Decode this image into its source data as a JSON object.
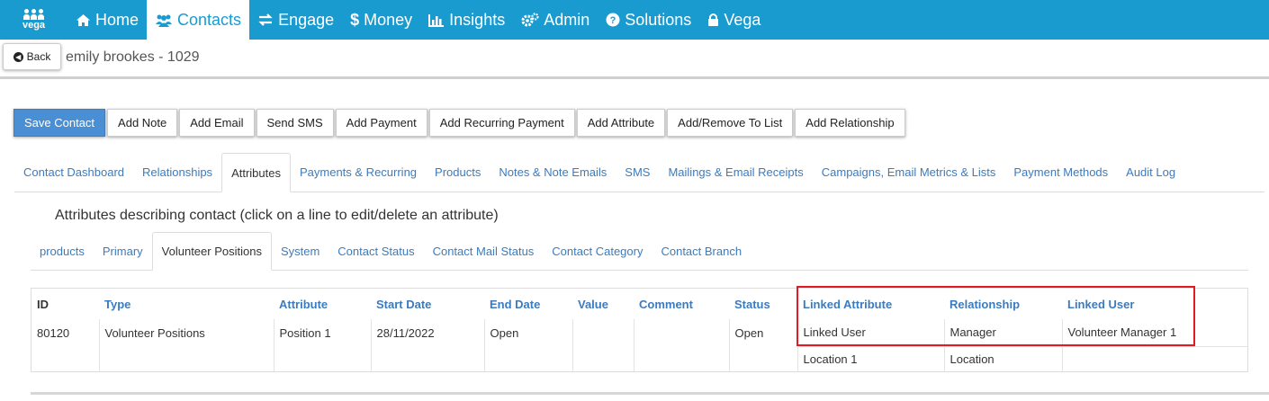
{
  "nav": {
    "logo_text": "vega",
    "items": [
      {
        "label": "Home",
        "icon": "home-icon"
      },
      {
        "label": "Contacts",
        "icon": "users-icon",
        "active": true
      },
      {
        "label": "Engage",
        "icon": "exchange-icon"
      },
      {
        "label": "Money",
        "icon": "dollar-icon"
      },
      {
        "label": "Insights",
        "icon": "bar-chart-icon"
      },
      {
        "label": "Admin",
        "icon": "cogs-icon"
      },
      {
        "label": "Solutions",
        "icon": "question-circle-icon"
      },
      {
        "label": "Vega",
        "icon": "lock-icon"
      }
    ],
    "bg_color": "#1a9bd0"
  },
  "header": {
    "back_label": "Back",
    "contact_title": "emily brookes - 1029"
  },
  "actions": [
    "Save Contact",
    "Add Note",
    "Add Email",
    "Send SMS",
    "Add Payment",
    "Add Recurring Payment",
    "Add Attribute",
    "Add/Remove To List",
    "Add Relationship"
  ],
  "main_tabs": [
    "Contact Dashboard",
    "Relationships",
    "Attributes",
    "Payments & Recurring",
    "Products",
    "Notes & Note Emails",
    "SMS",
    "Mailings & Email Receipts",
    "Campaigns, Email Metrics & Lists",
    "Payment Methods",
    "Audit Log"
  ],
  "main_tabs_active": "Attributes",
  "attributes_description": "Attributes describing contact (click on a line to edit/delete an attribute)",
  "attr_tabs": [
    "products",
    "Primary",
    "Volunteer Positions",
    "System",
    "Contact Status",
    "Contact Mail Status",
    "Contact Category",
    "Contact Branch"
  ],
  "attr_tabs_active": "Volunteer Positions",
  "table": {
    "headers": [
      "ID",
      "Type",
      "Attribute",
      "Start Date",
      "End Date",
      "Value",
      "Comment",
      "Status",
      "Linked Attribute",
      "Relationship",
      "Linked User"
    ],
    "row": {
      "id": "80120",
      "type": "Volunteer Positions",
      "attribute": "Position 1",
      "start_date": "28/11/2022",
      "end_date": "Open",
      "value": "",
      "comment": "",
      "status": "Open",
      "linked_attribute": "Linked User",
      "relationship": "Manager",
      "linked_user": "Volunteer Manager 1"
    },
    "sub_row": {
      "linked_attribute": "Location 1",
      "relationship": "Location",
      "linked_user": ""
    }
  },
  "colors": {
    "accent": "#1a9bd0",
    "link": "#3b7bbf",
    "primary_button": "#4a8fd4",
    "highlight_box": "#e01b24"
  }
}
